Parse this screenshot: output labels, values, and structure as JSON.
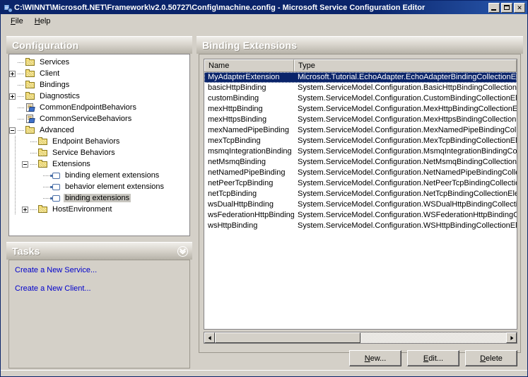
{
  "window": {
    "title": "C:\\WINNT\\Microsoft.NET\\Framework\\v2.0.50727\\Config\\machine.config - Microsoft Service Configuration Editor",
    "icon": "service-config-editor-icon",
    "controls": {
      "minimize": "_",
      "maximize": "□",
      "close": "✕"
    }
  },
  "menu": {
    "items": [
      {
        "label": "File",
        "accel": "F"
      },
      {
        "label": "Help",
        "accel": "H"
      }
    ]
  },
  "configuration_pane": {
    "header": "Configuration",
    "tree": [
      {
        "label": "Services",
        "depth": 0,
        "expander": "none",
        "icon": "folder-icon",
        "selected": false
      },
      {
        "label": "Client",
        "depth": 0,
        "expander": "plus",
        "icon": "folder-icon",
        "selected": false
      },
      {
        "label": "Bindings",
        "depth": 0,
        "expander": "none",
        "icon": "folder-icon",
        "selected": false
      },
      {
        "label": "Diagnostics",
        "depth": 0,
        "expander": "plus",
        "icon": "folder-icon",
        "selected": false
      },
      {
        "label": "CommonEndpointBehaviors",
        "depth": 0,
        "expander": "none",
        "icon": "behavior-doc-icon",
        "selected": false
      },
      {
        "label": "CommonServiceBehaviors",
        "depth": 0,
        "expander": "none",
        "icon": "behavior-doc-icon",
        "selected": false
      },
      {
        "label": "Advanced",
        "depth": 0,
        "expander": "minus",
        "icon": "folder-icon",
        "selected": false
      },
      {
        "label": "Endpoint Behaviors",
        "depth": 1,
        "expander": "none",
        "icon": "folder-icon",
        "selected": false
      },
      {
        "label": "Service Behaviors",
        "depth": 1,
        "expander": "none",
        "icon": "folder-icon",
        "selected": false
      },
      {
        "label": "Extensions",
        "depth": 1,
        "expander": "minus",
        "icon": "folder-icon",
        "selected": false
      },
      {
        "label": "binding element extensions",
        "depth": 2,
        "expander": "none",
        "icon": "extension-node-icon",
        "selected": false
      },
      {
        "label": "behavior element extensions",
        "depth": 2,
        "expander": "none",
        "icon": "extension-node-icon",
        "selected": false
      },
      {
        "label": "binding extensions",
        "depth": 2,
        "expander": "none",
        "icon": "extension-node-icon",
        "selected": true
      },
      {
        "label": "HostEnvironment",
        "depth": 1,
        "expander": "plus",
        "icon": "folder-icon",
        "selected": false
      }
    ]
  },
  "tasks_pane": {
    "header": "Tasks",
    "collapse_icon": "chevron-down-circle-icon",
    "links": [
      "Create a New Service...",
      "Create a New Client..."
    ]
  },
  "details_pane": {
    "header": "Binding Extensions",
    "columns": [
      "Name",
      "Type"
    ],
    "rows": [
      {
        "name": "MyAdapterExtension",
        "type": "Microsoft.Tutorial.EchoAdapter.EchoAdapterBindingCollectionEleme",
        "selected": true
      },
      {
        "name": "basicHttpBinding",
        "type": "System.ServiceModel.Configuration.BasicHttpBindingCollectionElem",
        "selected": false
      },
      {
        "name": "customBinding",
        "type": "System.ServiceModel.Configuration.CustomBindingCollectionElemen",
        "selected": false
      },
      {
        "name": "mexHttpBinding",
        "type": "System.ServiceModel.Configuration.MexHttpBindingCollectionEleme",
        "selected": false
      },
      {
        "name": "mexHttpsBinding",
        "type": "System.ServiceModel.Configuration.MexHttpsBindingCollectionElem",
        "selected": false
      },
      {
        "name": "mexNamedPipeBinding",
        "type": "System.ServiceModel.Configuration.MexNamedPipeBindingCollectio",
        "selected": false
      },
      {
        "name": "mexTcpBinding",
        "type": "System.ServiceModel.Configuration.MexTcpBindingCollectionEleme",
        "selected": false
      },
      {
        "name": "msmqIntegrationBinding",
        "type": "System.ServiceModel.Configuration.MsmqIntegrationBindingCollecti",
        "selected": false
      },
      {
        "name": "netMsmqBinding",
        "type": "System.ServiceModel.Configuration.NetMsmqBindingCollectionElem",
        "selected": false
      },
      {
        "name": "netNamedPipeBinding",
        "type": "System.ServiceModel.Configuration.NetNamedPipeBindingCollection",
        "selected": false
      },
      {
        "name": "netPeerTcpBinding",
        "type": "System.ServiceModel.Configuration.NetPeerTcpBindingCollectionEl",
        "selected": false
      },
      {
        "name": "netTcpBinding",
        "type": "System.ServiceModel.Configuration.NetTcpBindingCollectionElemen",
        "selected": false
      },
      {
        "name": "wsDualHttpBinding",
        "type": "System.ServiceModel.Configuration.WSDualHttpBindingCollectionEl",
        "selected": false
      },
      {
        "name": "wsFederationHttpBinding",
        "type": "System.ServiceModel.Configuration.WSFederationHttpBindingCollec",
        "selected": false
      },
      {
        "name": "wsHttpBinding",
        "type": "System.ServiceModel.Configuration.WSHttpBindingCollectionElemer",
        "selected": false
      }
    ],
    "buttons": [
      {
        "label": "New...",
        "accel": "N"
      },
      {
        "label": "Edit...",
        "accel": "E"
      },
      {
        "label": "Delete",
        "accel": "D"
      }
    ]
  },
  "colors": {
    "title_bar": "#0a246a",
    "selection": "#0a246a",
    "window_face": "#d4d0c8",
    "link": "#0000cc",
    "folder": "#f7e07a"
  }
}
